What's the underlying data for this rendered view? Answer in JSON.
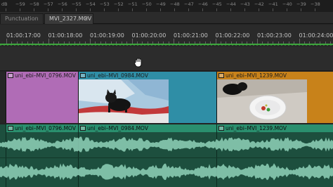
{
  "meter": {
    "scale": [
      "dB",
      "−59",
      "−58",
      "−57",
      "−56",
      "−55",
      "−54",
      "−53",
      "−52",
      "−51",
      "−50",
      "−49",
      "−48",
      "−47",
      "−46",
      "−45",
      "−44",
      "−43",
      "−42",
      "−41",
      "−40",
      "−39",
      "−38"
    ]
  },
  "tabs": [
    {
      "label": "Punctuation",
      "active": false
    },
    {
      "label": "MVI_2327.MOV",
      "active": true,
      "close": "×"
    }
  ],
  "ruler": {
    "timecodes": [
      "01:00:17:00",
      "01:00:18:00",
      "01:00:19:00",
      "01:00:20:00",
      "01:00:21:00",
      "01:00:22:00",
      "01:00:23:00",
      "01:00:24:00"
    ]
  },
  "video_clips": [
    {
      "label": "uni_ebi–MVI_0796.MOV",
      "color": "#b06cb6"
    },
    {
      "label": "uni_ebi–MVI_0984.MOV",
      "color": "#2f8ea6"
    },
    {
      "label": "uni_ebi–MVI_1239.MOV",
      "color": "#c8821a"
    }
  ],
  "audio_clips": [
    {
      "label": "uni_ebi–MVI_0796.MOV"
    },
    {
      "label": "uni_ebi–MVI_0984.MOV"
    },
    {
      "label": "uni_ebi–MVI_1239.MOV"
    }
  ],
  "colors": {
    "timeline_green": "#3ea43e",
    "audio_clip": "#1d4f3e",
    "waveform": "#8fd1b8"
  },
  "icons": {
    "cursor": "hand-grab-icon",
    "fx": "fx-badge-icon"
  }
}
